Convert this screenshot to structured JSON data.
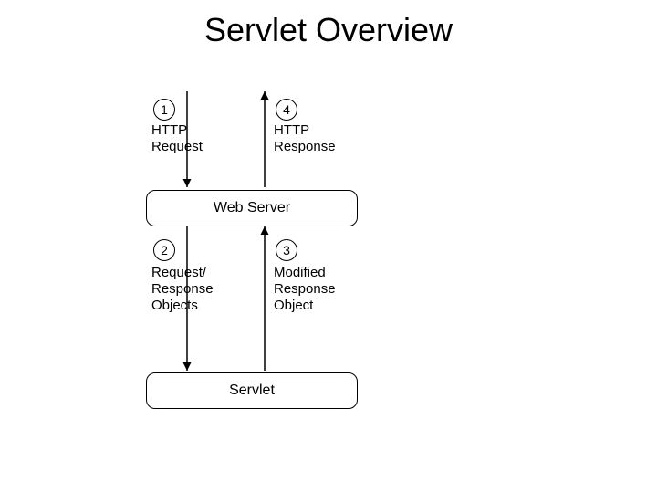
{
  "title": "Servlet Overview",
  "steps": {
    "s1": "1",
    "s2": "2",
    "s3": "3",
    "s4": "4"
  },
  "labels": {
    "http_request": "HTTP\nRequest",
    "http_response": "HTTP\nResponse",
    "req_resp_objects": "Request/\nResponse\nObjects",
    "mod_resp_object": "Modified\nResponse\nObject"
  },
  "boxes": {
    "web_server": "Web Server",
    "servlet": "Servlet"
  }
}
